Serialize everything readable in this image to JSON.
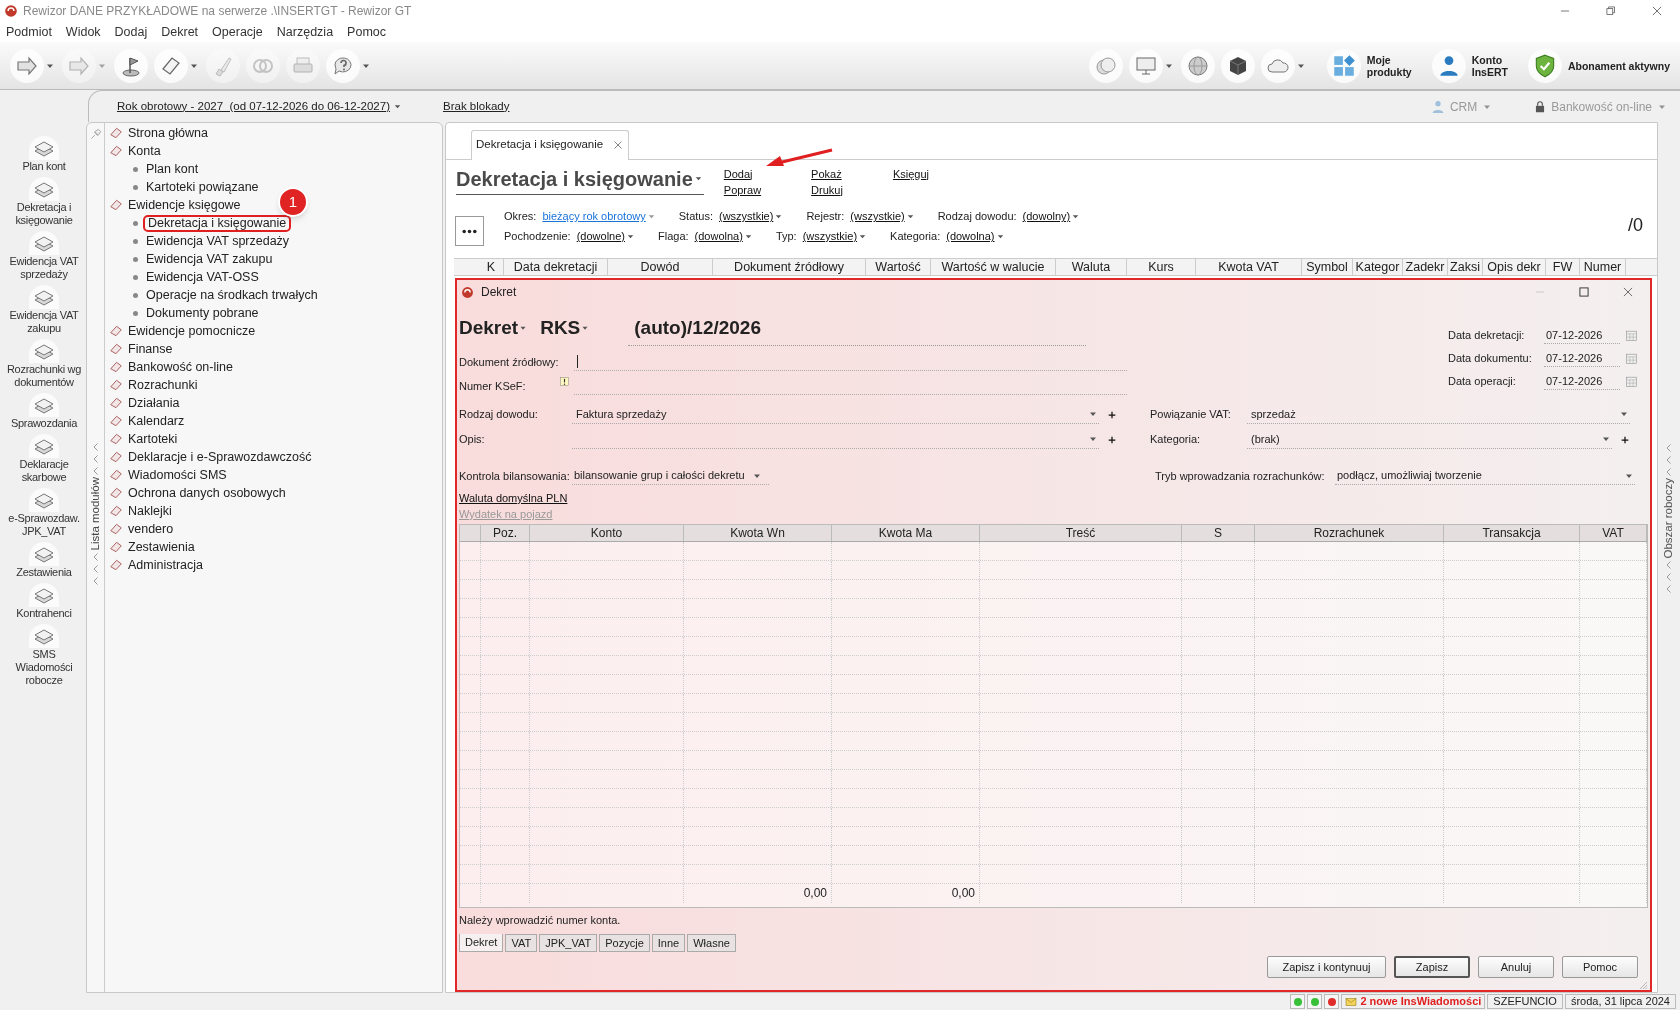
{
  "window": {
    "title": "Rewizor DANE PRZYKŁADOWE na serwerze .\\INSERTGT - Rewizor GT"
  },
  "menu": [
    "Podmiot",
    "Widok",
    "Dodaj",
    "Dekret",
    "Operacje",
    "Narzędzia",
    "Pomoc"
  ],
  "toolbar": {
    "left": [
      {
        "kind": "arrow",
        "dropdown": true,
        "disabled": false
      },
      {
        "kind": "arrow",
        "dropdown": true,
        "disabled": true
      },
      {
        "kind": "flag",
        "dropdown": false,
        "disabled": false
      },
      {
        "kind": "sheet",
        "dropdown": true,
        "disabled": false
      },
      {
        "kind": "brush",
        "dropdown": false,
        "disabled": true
      },
      {
        "kind": "rings",
        "dropdown": false,
        "disabled": true
      },
      {
        "kind": "printer",
        "dropdown": false,
        "disabled": true
      },
      {
        "kind": "help",
        "dropdown": true,
        "disabled": false
      }
    ],
    "right": [
      {
        "kind": "coins",
        "dropdown": false
      },
      {
        "kind": "monitor",
        "dropdown": true
      },
      {
        "kind": "globe",
        "dropdown": false
      },
      {
        "kind": "cube",
        "dropdown": false
      },
      {
        "kind": "cloud",
        "dropdown": true
      },
      {
        "kind": "tiles",
        "label": "Moje\nprodukty"
      },
      {
        "kind": "person",
        "label": "Konto\nInsERT"
      },
      {
        "kind": "shield",
        "label": "Abonament aktywny"
      }
    ]
  },
  "year_bar": {
    "period": "Rok obrotowy - 2027  (od 07-12-2026 do 06-12-2027)",
    "lock": "Brak blokady",
    "crm": "CRM",
    "banking": "Bankowość on-line"
  },
  "side_modules": [
    "Plan kont",
    "Dekretacja i\nksięgowanie",
    "Ewidencja VAT\nsprzedaży",
    "Ewidencja VAT\nzakupu",
    "Rozrachunki wg\ndokumentów",
    "Sprawozdania",
    "Deklaracje\nskarbowe",
    "e-Sprawozdaw.\nJPK_VAT",
    "Zestawienia",
    "Kontrahenci",
    "SMS\nWiadomości\nrobocze"
  ],
  "module_list": {
    "title": "Lista modułów",
    "items": [
      {
        "label": "Strona główna"
      },
      {
        "label": "Konta",
        "children": [
          {
            "label": "Plan kont",
            "selected": false
          },
          {
            "label": "Kartoteki powiązane",
            "selected": false
          }
        ]
      },
      {
        "label": "Ewidencje księgowe",
        "children": [
          {
            "label": "Dekretacja i księgowanie",
            "selected": true
          },
          {
            "label": "Ewidencja VAT sprzedaży",
            "selected": false
          },
          {
            "label": "Ewidencja VAT zakupu",
            "selected": false
          },
          {
            "label": "Ewidencja VAT-OSS",
            "selected": false
          },
          {
            "label": "Operacje na środkach trwałych",
            "selected": false
          },
          {
            "label": "Dokumenty pobrane",
            "selected": false
          }
        ]
      },
      {
        "label": "Ewidencje pomocnicze"
      },
      {
        "label": "Finanse"
      },
      {
        "label": "Bankowość on-line"
      },
      {
        "label": "Rozrachunki"
      },
      {
        "label": "Działania"
      },
      {
        "label": "Kalendarz"
      },
      {
        "label": "Kartoteki"
      },
      {
        "label": "Deklaracje i e-Sprawozdawczość"
      },
      {
        "label": "Wiadomości SMS"
      },
      {
        "label": "Ochrona danych osobowych"
      },
      {
        "label": "Naklejki"
      },
      {
        "label": "vendero"
      },
      {
        "label": "Zestawienia"
      },
      {
        "label": "Administracja"
      }
    ]
  },
  "annotation": {
    "step": "1"
  },
  "workspace_label": "Obszar roboczy",
  "tab": {
    "label": "Dekretacja i księgowanie"
  },
  "view": {
    "title": "Dekretacja i księgowanie",
    "actions": [
      [
        "Dodaj",
        "Popraw"
      ],
      [
        "Pokaż",
        "Drukuj"
      ],
      [
        "Księguj"
      ]
    ],
    "filters": [
      [
        {
          "label": "Okres:",
          "value": "bieżący rok obrotowy",
          "active": true
        },
        {
          "label": "Status:",
          "value": "(wszystkie)",
          "active": false
        },
        {
          "label": "Rejestr:",
          "value": "(wszystkie)",
          "active": false
        },
        {
          "label": "Rodzaj dowodu:",
          "value": "(dowolny)",
          "active": false
        }
      ],
      [
        {
          "label": "Pochodzenie:",
          "value": "(dowolne)",
          "active": false
        },
        {
          "label": "Flaga:",
          "value": "(dowolna)",
          "active": false
        },
        {
          "label": "Typ:",
          "value": "(wszystkie)",
          "active": false
        },
        {
          "label": "Kategoria:",
          "value": "(dowolna)",
          "active": false
        }
      ]
    ],
    "count": "/0",
    "columns": [
      "K",
      "Data dekretacji",
      "Dowód",
      "Dokument źródłowy",
      "Wartość",
      "Wartość w walucie",
      "Waluta",
      "Kurs",
      "Kwota VAT",
      "Symbol",
      "Kategor",
      "Zadekr",
      "Zaksi",
      "Opis dekr",
      "FW",
      "Numer"
    ]
  },
  "dialog": {
    "title": "Dekret",
    "doc_type": "Dekret",
    "register": "RKS",
    "number": "(auto)/12/2026",
    "dates": [
      {
        "label": "Data dekretacji:",
        "value": "07-12-2026"
      },
      {
        "label": "Data dokumentu:",
        "value": "07-12-2026"
      },
      {
        "label": "Data operacji:",
        "value": "07-12-2026"
      }
    ],
    "source_document": {
      "label": "Dokument źródłowy:"
    },
    "ksef": {
      "label": "Numer KSeF:"
    },
    "left_fields": [
      {
        "label": "Rodzaj dowodu:",
        "value": "Faktura sprzedaży",
        "plus": true
      },
      {
        "label": "Opis:",
        "plus": true
      }
    ],
    "right_fields": [
      {
        "label": "Powiązanie VAT:",
        "value": "sprzedaż",
        "plus": false
      },
      {
        "label": "Kategoria:",
        "value": "(brak)",
        "plus": true
      }
    ],
    "balance": {
      "label": "Kontrola bilansowania:",
      "value": "bilansowanie grup i całości dekretu"
    },
    "settlement_mode": {
      "label": "Tryb wprowadzania rozrachunków:",
      "value": "podłącz, umożliwiaj tworzenie"
    },
    "links": [
      {
        "label": "Waluta domyślna PLN",
        "disabled": false
      },
      {
        "label": "Wydatek na pojazd",
        "disabled": true
      }
    ],
    "columns": [
      "Poz.",
      "Konto",
      "Kwota Wn",
      "Kwota Ma",
      "Treść",
      "S",
      "Rozrachunek",
      "Transakcja",
      "VAT"
    ],
    "totals": {
      "debit": "0,00",
      "credit": "0,00"
    },
    "message": "Należy wprowadzić numer konta.",
    "tabs": [
      {
        "label": "Dekret",
        "selected": true
      },
      {
        "label": "VAT",
        "selected": false
      },
      {
        "label": "JPK_VAT",
        "selected": false
      },
      {
        "label": "Pozycje",
        "selected": false
      },
      {
        "label": "Inne",
        "selected": false
      },
      {
        "label": "Własne",
        "selected": false
      }
    ],
    "buttons": [
      {
        "label": "Zapisz i kontynuuj",
        "default": false
      },
      {
        "label": "Zapisz",
        "default": true
      },
      {
        "label": "Anuluj",
        "default": false
      },
      {
        "label": "Pomoc",
        "default": false
      }
    ]
  },
  "status_bar": {
    "indicators": [
      {
        "color": "#38c038"
      },
      {
        "color": "#38c038"
      },
      {
        "color": "#e02b2b"
      }
    ],
    "messages": "2 nowe InsWiadomości",
    "user": "SZEFUNCIO",
    "date": "środa, 31 lipca 2024"
  }
}
